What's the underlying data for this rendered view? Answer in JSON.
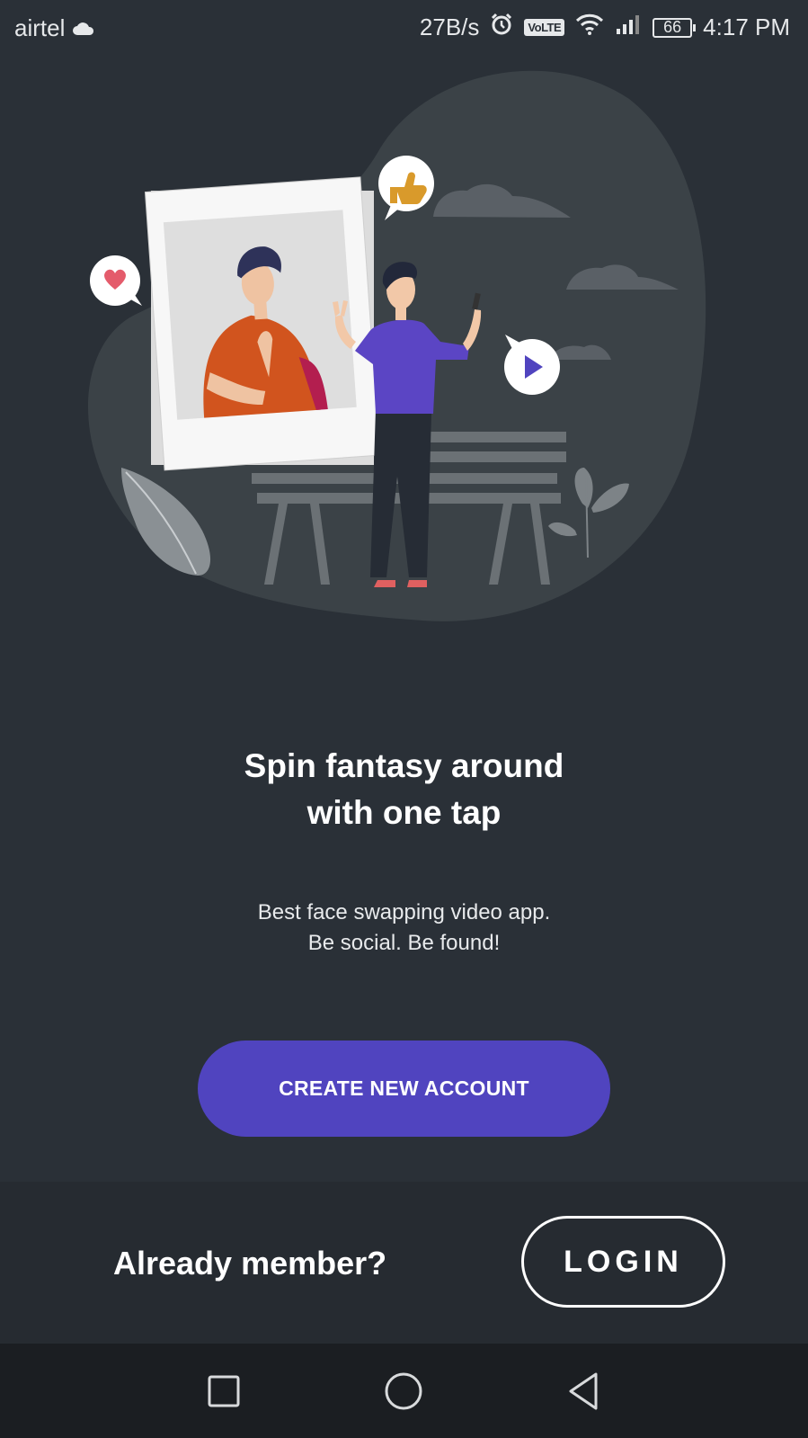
{
  "status_bar": {
    "carrier": "airtel",
    "cloud_icon": "cloud-icon",
    "net_speed": "27B/s",
    "alarm_icon": "alarm-icon",
    "volte": "VoLTE",
    "wifi_icon": "wifi-icon",
    "signal_icon": "signal-icon",
    "battery": "66",
    "time": "4:17 PM"
  },
  "illustration": {
    "icons": [
      "heart-bubble-icon",
      "thumbs-up-bubble-icon",
      "play-bubble-icon"
    ]
  },
  "headline": {
    "line1": "Spin fantasy around",
    "line2": "with one tap"
  },
  "subtext": {
    "line1": "Best face swapping video app.",
    "line2": "Be social. Be found!"
  },
  "actions": {
    "create_account_label": "CREATE NEW ACCOUNT",
    "already_member_label": "Already member?",
    "login_label": "LOGIN"
  },
  "navigation": {
    "icons": [
      "recent-apps-icon",
      "home-icon",
      "back-icon"
    ]
  },
  "colors": {
    "background": "#2a3037",
    "bottom_panel": "#262b31",
    "accent": "#5044bf",
    "navbar": "#1b1e22"
  }
}
